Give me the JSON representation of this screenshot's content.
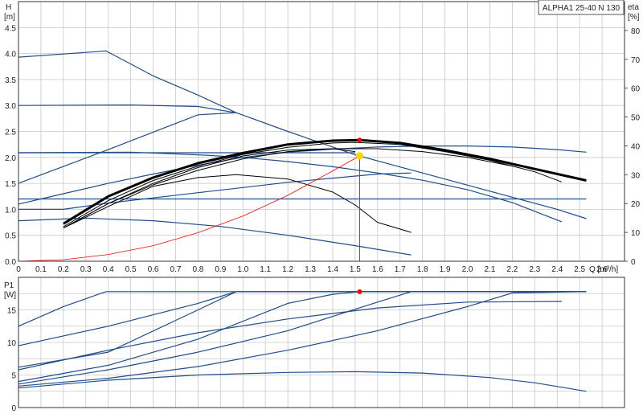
{
  "chart_data": [
    {
      "type": "line",
      "title": "ALPHA1 25-40 N 130",
      "ylabel": "H",
      "ylabel_unit": "[m]",
      "y2label": "eta",
      "y2label_unit": "[%]",
      "xlabel": "Q [m³/h]",
      "xlim": [
        0,
        2.7
      ],
      "ylim": [
        0,
        5.0
      ],
      "y2lim": [
        0,
        90
      ],
      "x_ticks": [
        "0",
        "0.1",
        "0.2",
        "0.3",
        "0.4",
        "0.5",
        "0.6",
        "0.7",
        "0.8",
        "0.9",
        "1.0",
        "1.1",
        "1.2",
        "1.3",
        "1.4",
        "1.5",
        "1.6",
        "1.7",
        "1.8",
        "1.9",
        "2.0",
        "2.1",
        "2.2",
        "2.3",
        "2.4",
        "2.5",
        "2.6"
      ],
      "y_ticks": [
        "0.0",
        "0.5",
        "1.0",
        "1.5",
        "2.0",
        "2.5",
        "3.0",
        "3.5",
        "4.0",
        "4.5"
      ],
      "y2_ticks": [
        "0",
        "10",
        "20",
        "30",
        "40",
        "50",
        "60",
        "70",
        "80"
      ],
      "grid": true,
      "series": [
        {
          "axis": "left",
          "color": "#1f4e8c",
          "width": 1.2,
          "x": [
            0,
            0.2,
            0.4,
            0.6,
            0.8,
            1.0,
            1.2,
            1.4,
            1.6,
            1.8,
            2.0,
            2.2,
            2.4,
            2.53
          ],
          "y": [
            1.1,
            1.3,
            1.5,
            1.68,
            1.85,
            2.0,
            2.1,
            2.16,
            2.2,
            2.22,
            2.22,
            2.2,
            2.15,
            2.1
          ]
        },
        {
          "axis": "left",
          "color": "#1f4e8c",
          "width": 1.2,
          "x": [
            0,
            0.39,
            0.6,
            0.8,
            0.97,
            1.2,
            1.5,
            1.8,
            2.1,
            2.4,
            2.53
          ],
          "y": [
            3.93,
            4.05,
            3.57,
            3.2,
            2.86,
            2.5,
            2.05,
            1.7,
            1.35,
            1.0,
            0.82
          ]
        },
        {
          "axis": "left",
          "color": "#1f4e8c",
          "width": 1.2,
          "x": [
            0,
            0.5,
            0.8,
            0.97
          ],
          "y": [
            3.0,
            3.01,
            2.98,
            2.86
          ]
        },
        {
          "axis": "left",
          "color": "#1f4e8c",
          "width": 1.2,
          "x": [
            0,
            0.4,
            0.8,
            0.97
          ],
          "y": [
            1.5,
            2.15,
            2.82,
            2.86
          ]
        },
        {
          "axis": "left",
          "color": "#1f4e8c",
          "width": 1.2,
          "x": [
            0,
            0.5,
            0.8,
            1.0,
            1.2,
            1.4,
            1.5
          ],
          "y": [
            2.09,
            2.09,
            2.09,
            2.09,
            2.09,
            2.09,
            2.09
          ]
        },
        {
          "axis": "left",
          "color": "#1f4e8c",
          "width": 1.2,
          "x": [
            0,
            0.5,
            0.8,
            1.0,
            1.2,
            1.4,
            1.6,
            1.8,
            2.0,
            2.2,
            2.42
          ],
          "y": [
            2.09,
            2.1,
            2.05,
            2.0,
            1.92,
            1.82,
            1.7,
            1.56,
            1.38,
            1.13,
            0.76
          ]
        },
        {
          "axis": "left",
          "color": "#1f4e8c",
          "width": 1.2,
          "x": [
            0,
            2.53
          ],
          "y": [
            1.2,
            1.2
          ]
        },
        {
          "axis": "left",
          "color": "#1f4e8c",
          "width": 1.2,
          "x": [
            0,
            0.2,
            0.4,
            0.6,
            0.8,
            1.0,
            1.2,
            1.4,
            1.6,
            1.75
          ],
          "y": [
            1.0,
            1.0,
            1.12,
            1.22,
            1.32,
            1.42,
            1.52,
            1.6,
            1.68,
            1.7
          ]
        },
        {
          "axis": "left",
          "color": "#1f4e8c",
          "width": 1.2,
          "x": [
            0,
            0.3,
            0.6,
            0.9,
            1.2,
            1.5,
            1.75
          ],
          "y": [
            0.78,
            0.83,
            0.78,
            0.67,
            0.5,
            0.3,
            0.12
          ]
        },
        {
          "axis": "right",
          "color": "#000000",
          "width": 3,
          "x": [
            0.2,
            0.4,
            0.6,
            0.8,
            1.0,
            1.2,
            1.4,
            1.52,
            1.7,
            1.9,
            2.1,
            2.3,
            2.53
          ],
          "y": [
            13,
            22.5,
            29,
            34,
            37.5,
            40.5,
            41.8,
            42,
            41,
            38.5,
            35.5,
            32,
            28
          ]
        },
        {
          "axis": "right",
          "color": "#000000",
          "width": 1,
          "x": [
            0.2,
            0.4,
            0.6,
            0.8,
            1.0,
            1.2,
            1.4,
            1.5,
            1.7,
            1.9,
            2.1,
            2.3,
            2.42
          ],
          "y": [
            12,
            21,
            28,
            33,
            37,
            39.5,
            41,
            41.2,
            40.5,
            38,
            35,
            31,
            27.5
          ]
        },
        {
          "axis": "right",
          "color": "#000000",
          "width": 1,
          "x": [
            0.2,
            0.4,
            0.6,
            0.8,
            1.0,
            1.2,
            1.4,
            1.5
          ],
          "y": [
            11.5,
            20,
            27,
            32.5,
            36.5,
            38.5,
            39,
            38
          ]
        },
        {
          "axis": "right",
          "color": "#000000",
          "width": 1,
          "x": [
            0.2,
            0.4,
            0.6,
            0.8,
            0.97,
            1.2,
            1.4,
            1.5,
            1.6,
            1.75
          ],
          "y": [
            11.5,
            19,
            26,
            29,
            30,
            28.5,
            24,
            19.5,
            13.5,
            10
          ]
        },
        {
          "axis": "right",
          "color": "#000000",
          "width": 1,
          "x": [
            0.2,
            0.4,
            0.6,
            0.8,
            1.0,
            1.2,
            1.4,
            1.6,
            1.8,
            2.0,
            2.2
          ],
          "y": [
            11.5,
            20,
            26.5,
            31.5,
            35.5,
            38,
            39,
            39,
            38,
            36,
            33
          ]
        },
        {
          "axis": "left",
          "color": "#ff0000",
          "width": 0.8,
          "x": [
            0,
            0.2,
            0.4,
            0.6,
            0.8,
            1.0,
            1.2,
            1.4,
            1.52
          ],
          "y": [
            0,
            0.03,
            0.13,
            0.3,
            0.55,
            0.87,
            1.27,
            1.74,
            2.03
          ]
        }
      ],
      "operating_point": {
        "q": 1.52,
        "h": 2.03,
        "eta": 42,
        "color_point": "#ff0000",
        "color_marker": "#ffd400"
      }
    },
    {
      "type": "line",
      "title": "",
      "ylabel": "P1",
      "ylabel_unit": "[W]",
      "xlim": [
        0,
        2.7
      ],
      "ylim": [
        0,
        20
      ],
      "y_ticks": [
        "0",
        "5",
        "10",
        "15"
      ],
      "grid": true,
      "series": [
        {
          "color": "#1f4e8c",
          "width": 1.2,
          "x": [
            0,
            0.2,
            0.39,
            2.53
          ],
          "y": [
            12.5,
            15.5,
            17.8,
            17.8
          ]
        },
        {
          "color": "#1f4e8c",
          "width": 1.2,
          "x": [
            0,
            0.4,
            0.8,
            0.97,
            2.53
          ],
          "y": [
            9.5,
            12.5,
            16,
            17.8,
            17.8
          ]
        },
        {
          "color": "#1f4e8c",
          "width": 1.2,
          "x": [
            0,
            0.4,
            0.8,
            0.97,
            2.53
          ],
          "y": [
            6.2,
            8.5,
            15.0,
            17.8,
            17.8
          ]
        },
        {
          "color": "#1f4e8c",
          "width": 1.2,
          "x": [
            0,
            0.4,
            0.8,
            1.2,
            1.4,
            1.52,
            2.53
          ],
          "y": [
            4.0,
            6.5,
            10.5,
            16.0,
            17.4,
            17.8,
            17.8
          ]
        },
        {
          "color": "#1f4e8c",
          "width": 1.2,
          "x": [
            0,
            0.4,
            0.8,
            1.2,
            1.6,
            1.75,
            2.53
          ],
          "y": [
            3.6,
            5.8,
            8.5,
            11.8,
            16.2,
            17.8,
            17.8
          ]
        },
        {
          "color": "#1f4e8c",
          "width": 1.2,
          "x": [
            0,
            0.4,
            0.8,
            1.2,
            1.6,
            2.0,
            2.2,
            2.53
          ],
          "y": [
            3.3,
            4.5,
            6.3,
            8.8,
            11.8,
            15.5,
            17.6,
            17.8
          ]
        },
        {
          "color": "#1f4e8c",
          "width": 1.2,
          "x": [
            0,
            0.4,
            0.8,
            1.2,
            1.6,
            2.0,
            2.42
          ],
          "y": [
            5.8,
            8.8,
            11.5,
            13.6,
            15.3,
            16.2,
            16.3
          ]
        },
        {
          "color": "#1f4e8c",
          "width": 1.2,
          "x": [
            0,
            0.4,
            0.8,
            1.2,
            1.5,
            1.8,
            2.1,
            2.3,
            2.53
          ],
          "y": [
            3.0,
            4.2,
            5.0,
            5.4,
            5.5,
            5.3,
            4.6,
            3.8,
            2.5
          ]
        }
      ],
      "operating_point": {
        "q": 1.52,
        "p": 17.8,
        "color_point": "#ff0000"
      }
    }
  ]
}
